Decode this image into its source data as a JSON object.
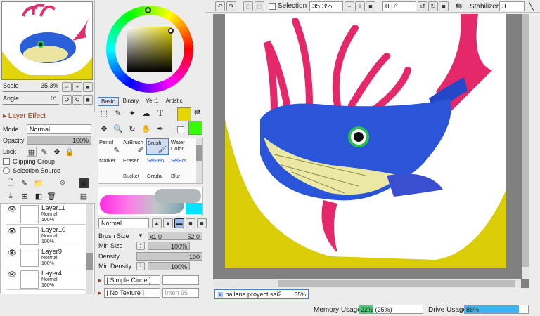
{
  "navigator": {
    "scale_label": "Scale",
    "scale_value": "35.3%",
    "angle_label": "Angle",
    "angle_value": "0°"
  },
  "layer_effect": {
    "title": "Layer Effect",
    "mode_label": "Mode",
    "mode_value": "Normal",
    "opacity_label": "Opacity",
    "opacity_value": "100%",
    "lock_label": "Lock",
    "clipping_label": "Clipping Group",
    "selsource_label": "Selection Source"
  },
  "layers": [
    {
      "name": "Layer11",
      "mode": "Normal",
      "opacity": "100%"
    },
    {
      "name": "Layer10",
      "mode": "Normal",
      "opacity": "100%"
    },
    {
      "name": "Layer9",
      "mode": "Normal",
      "opacity": "100%"
    },
    {
      "name": "Layer4",
      "mode": "Normal",
      "opacity": "100%"
    }
  ],
  "color_tabs": [
    "Basic",
    "Binary",
    "Ver.1",
    "Artistic"
  ],
  "tool_glyphs": {
    "select": "⬚",
    "lasso": "✎",
    "wand": "✦",
    "shape": "☁",
    "text": "T",
    "move": "✥",
    "zoom": "🔍",
    "rotate": "↻",
    "hand": "✋",
    "eyedrop": "✒"
  },
  "brushes": [
    "Pencil",
    "AirBrush",
    "Brush",
    "Water Color",
    "Marker",
    "Eraser",
    "SelPen",
    "SelErs",
    "",
    "Bucket",
    "Grada-",
    "Blur"
  ],
  "brush_settings": {
    "mode_value": "Normal",
    "size_label": "Brush Size",
    "size_mult": "x1.0",
    "size_value": "52.0",
    "min_size_label": "Min Size",
    "min_size_value": "100%",
    "density_label": "Density",
    "density_value": "100",
    "min_density_label": "Min Density",
    "min_density_value": "100%",
    "shape_value": "[ Simple Circle ]",
    "texture_value": "[ No Texture ]",
    "texture_intensity": "Inten 95"
  },
  "toolbar": {
    "selection_label": "Selection",
    "zoom_value": "35.3%",
    "angle_value": "0.0°",
    "stabilizer_label": "Stabilizer",
    "stabilizer_value": "3"
  },
  "document": {
    "tab_name": "ballena proyect.sai2",
    "tab_zoom": "35%"
  },
  "status": {
    "memory_label": "Memory Usage",
    "memory_value": "22% (25%)",
    "memory_fraction": 0.22,
    "drive_label": "Drive Usage",
    "drive_value": "86%",
    "drive_fraction": 0.86
  },
  "colors": {
    "primary": "#e6d600",
    "secondary": "#33ff00",
    "accent": "#4a7fc8"
  }
}
